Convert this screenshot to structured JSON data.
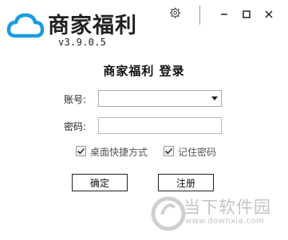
{
  "app": {
    "logo_icon": "cloud-icon",
    "logo_text": "商家福利",
    "version": "v3.9.0.5"
  },
  "window_controls": {
    "settings_icon": "gear-icon",
    "minimize_icon": "minimize-icon",
    "maximize_icon": "maximize-icon",
    "close_icon": "close-icon"
  },
  "login": {
    "title": "商家福利  登录",
    "account_label": "账号:",
    "account_value": "",
    "password_label": "密码:",
    "password_value": "",
    "desktop_shortcut_label": "桌面快捷方式",
    "desktop_shortcut_checked": true,
    "remember_password_label": "记住密码",
    "remember_password_checked": true,
    "confirm_button": "确定",
    "register_button": "注册"
  },
  "watermark": {
    "text": "当下软件园",
    "url": "www.downxia.com"
  },
  "colors": {
    "logo_blue": "#1a9be0",
    "watermark_gray": "#c4c4c4"
  }
}
